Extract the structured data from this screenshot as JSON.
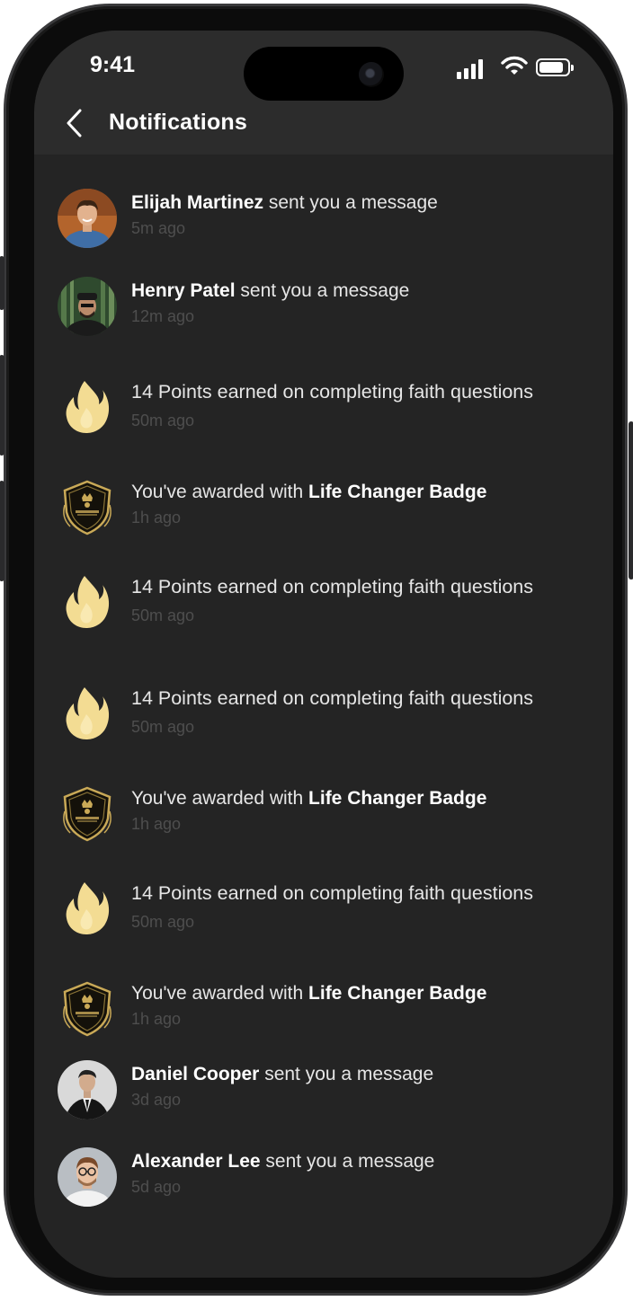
{
  "status_bar": {
    "time": "9:41"
  },
  "header": {
    "title": "Notifications"
  },
  "notifications": [
    {
      "kind": "message",
      "name": "Elijah Martinez",
      "text": " sent you a message",
      "time": "5m ago"
    },
    {
      "kind": "message",
      "name": "Henry Patel",
      "text": " sent you a message",
      "time": "12m ago"
    },
    {
      "kind": "points",
      "text": "14 Points earned on completing faith questions",
      "time": "50m ago"
    },
    {
      "kind": "badge",
      "text": "You've awarded with ",
      "badge": "Life Changer Badge",
      "time": "1h ago"
    },
    {
      "kind": "points",
      "text": "14 Points earned on completing faith questions",
      "time": "50m ago"
    },
    {
      "kind": "points",
      "text": "14 Points earned on completing faith questions",
      "time": "50m ago"
    },
    {
      "kind": "badge",
      "text": "You've awarded with ",
      "badge": "Life Changer Badge",
      "time": "1h ago"
    },
    {
      "kind": "points",
      "text": "14 Points earned on completing faith questions",
      "time": "50m ago"
    },
    {
      "kind": "badge",
      "text": "You've awarded with ",
      "badge": "Life Changer Badge",
      "time": "1h ago"
    },
    {
      "kind": "message",
      "name": "Daniel Cooper",
      "text": " sent you a message",
      "time": "3d ago"
    },
    {
      "kind": "message",
      "name": "Alexander Lee",
      "text": " sent you a message",
      "time": "5d ago"
    }
  ],
  "icons": {
    "back": "chevron-left-icon",
    "points": "flame-icon",
    "badge": "shield-badge-icon"
  },
  "colors": {
    "background": "#242424",
    "header": "#2c2c2c",
    "flame": "#f3dc93",
    "badge_gold": "#c9a957",
    "muted_text": "#4e4e4e"
  }
}
